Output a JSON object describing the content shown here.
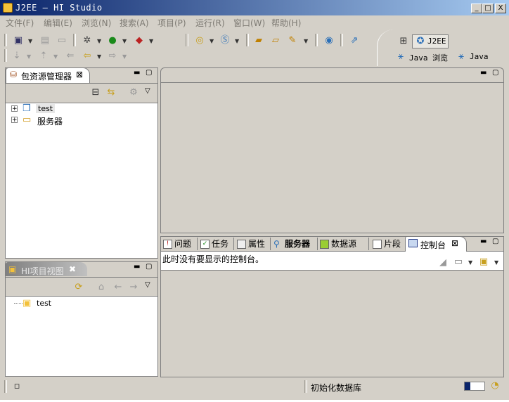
{
  "window": {
    "title": "J2EE — HI Studio",
    "min_label": "_",
    "max_label": "□",
    "close_label": "X"
  },
  "menu": {
    "items": [
      "文件(F)",
      "编辑(E)",
      "浏览(N)",
      "搜索(A)",
      "项目(P)",
      "运行(R)",
      "窗口(W)",
      "帮助(H)"
    ]
  },
  "perspectives": {
    "j2ee": "J2EE",
    "java_browse": "Java 浏览",
    "java": "Java"
  },
  "package_explorer": {
    "tab_label": "包资源管理器",
    "items": [
      "test",
      "服务器"
    ]
  },
  "hi_project_view": {
    "tab_label": "HI项目视图",
    "items": [
      "test"
    ]
  },
  "bottom_tabs": {
    "problems": "问题",
    "tasks": "任务",
    "properties": "属性",
    "servers": "服务器",
    "datasource": "数据源",
    "snippets": "片段",
    "console": "控制台"
  },
  "console": {
    "message": "此时没有要显示的控制台。"
  },
  "status": {
    "text": "初始化数据库"
  },
  "colors": {
    "title_gradient_start": "#0a246a",
    "title_gradient_end": "#a6caf0",
    "inactive_tab_start": "#808080",
    "inactive_tab_end": "#c0c0c0",
    "chrome": "#d4d0c8"
  }
}
